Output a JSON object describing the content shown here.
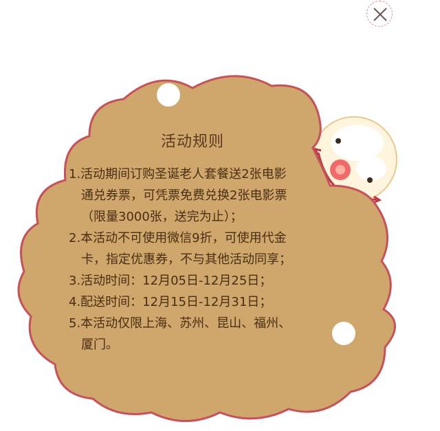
{
  "dialog": {
    "title": "活动规则",
    "close_icon": "close-icon",
    "mascot_icon": "santa-face-icon",
    "colors": {
      "panel": "#cfa66b",
      "panel_border": "#c8505a",
      "text": "#4a2e14",
      "title": "#5a3a1e"
    },
    "rules": [
      {
        "lines": [
          "1.活动期间订购圣诞老人套餐送2张电影",
          "通兑券票，可凭票免费兑换2张电影票",
          "（限量3000张，送完为止）；"
        ]
      },
      {
        "lines": [
          "2.本活动不可使用微信9折，可使用代金",
          "卡，指定优惠券，不与其他活动同享；"
        ]
      },
      {
        "lines": [
          "3.活动时间：12月05日-12月25日；"
        ]
      },
      {
        "lines": [
          "4.配送时间：12月15日-12月31日；"
        ]
      },
      {
        "lines": [
          "5.本活动仅限上海、苏州、昆山、福州、",
          "厦门。"
        ]
      }
    ]
  }
}
